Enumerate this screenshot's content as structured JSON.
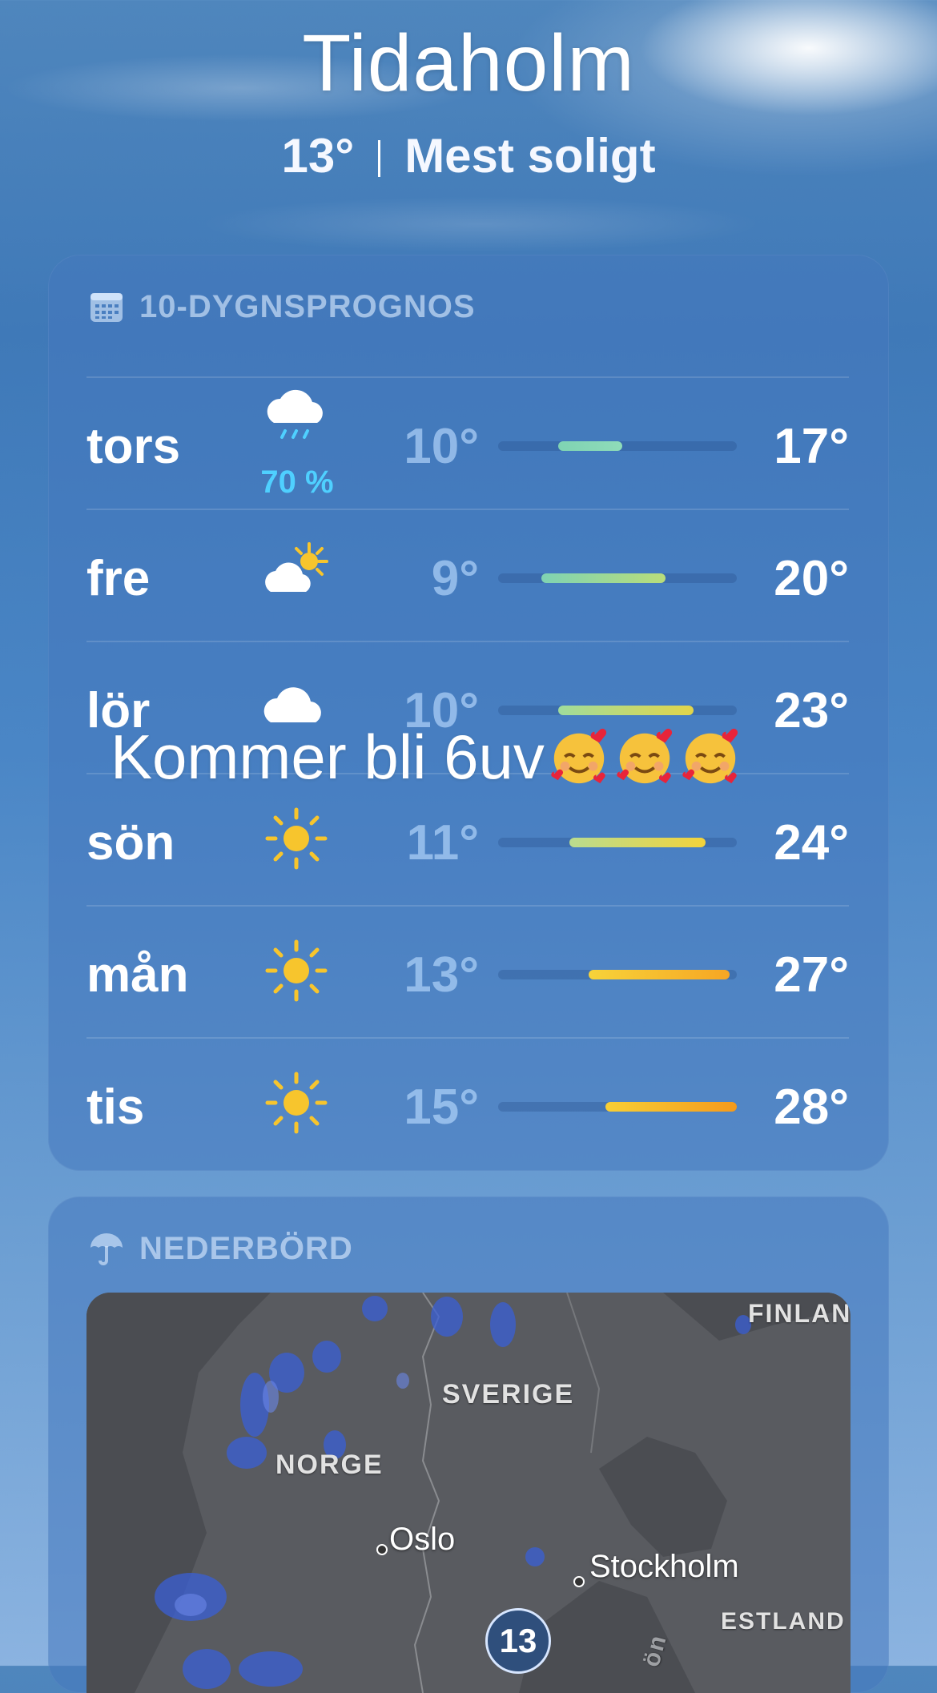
{
  "location": {
    "city": "Tidaholm",
    "current_temp": "13°",
    "condition": "Mest soligt"
  },
  "forecast": {
    "header": "10-DYGNSPROGNOS",
    "days": [
      {
        "day": "tors",
        "icon": "cloud-rain-icon",
        "pop": "70 %",
        "low": "10°",
        "high": "17°",
        "range_start": 0.25,
        "range_end": 0.52,
        "color_a": "#7fd3b3",
        "color_b": "#8fdcb9"
      },
      {
        "day": "fre",
        "icon": "cloud-sun-icon",
        "pop": "",
        "low": "9°",
        "high": "20°",
        "range_start": 0.18,
        "range_end": 0.7,
        "color_a": "#7fd3b3",
        "color_b": "#b9dd7a"
      },
      {
        "day": "lör",
        "icon": "cloud-icon",
        "pop": "",
        "low": "10°",
        "high": "23°",
        "range_start": 0.25,
        "range_end": 0.82,
        "color_a": "#9fdc9c",
        "color_b": "#e2d54a"
      },
      {
        "day": "sön",
        "icon": "sun-icon",
        "pop": "",
        "low": "11°",
        "high": "24°",
        "range_start": 0.3,
        "range_end": 0.87,
        "color_a": "#b9dc8f",
        "color_b": "#f3d33b"
      },
      {
        "day": "mån",
        "icon": "sun-icon",
        "pop": "",
        "low": "13°",
        "high": "27°",
        "range_start": 0.38,
        "range_end": 0.97,
        "color_a": "#f7d33a",
        "color_b": "#f6a623"
      },
      {
        "day": "tis",
        "icon": "sun-icon",
        "pop": "",
        "low": "15°",
        "high": "28°",
        "range_start": 0.45,
        "range_end": 1.0,
        "color_a": "#f8cf35",
        "color_b": "#f59a1c"
      }
    ]
  },
  "overlay": {
    "text": "Kommer bli 6uv",
    "emoji_count": 3,
    "emoji": "smiling-face-with-hearts"
  },
  "precipitation": {
    "header": "NEDERBÖRD",
    "map_labels": {
      "country_1": "SVERIGE",
      "country_2": "NORGE",
      "country_3": "FINLAN",
      "country_4": "ESTLAND",
      "city_1": "Oslo",
      "city_2": "Stockholm",
      "water": "ön"
    },
    "marker_temp": "13"
  }
}
